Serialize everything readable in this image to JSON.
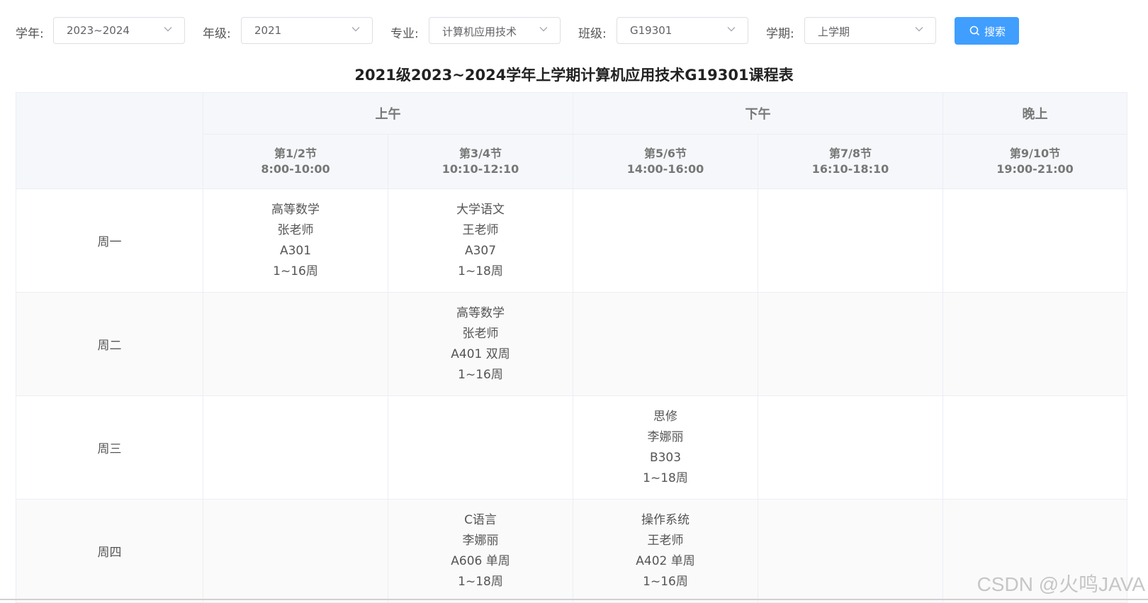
{
  "filters": [
    {
      "label": "学年:",
      "value": "2023~2024"
    },
    {
      "label": "年级:",
      "value": "2021"
    },
    {
      "label": "专业:",
      "value": "计算机应用技术"
    },
    {
      "label": "班级:",
      "value": "G19301"
    },
    {
      "label": "学期:",
      "value": "上学期"
    }
  ],
  "search_button": {
    "label": "搜索",
    "icon": "search-icon",
    "color": "#409eff"
  },
  "title": "2021级2023~2024学年上学期计算机应用技术G19301课程表",
  "table": {
    "groups": [
      "上午",
      "下午",
      "晚上"
    ],
    "periods": [
      {
        "name": "第1/2节",
        "time": "8:00-10:00"
      },
      {
        "name": "第3/4节",
        "time": "10:10-12:10"
      },
      {
        "name": "第5/6节",
        "time": "14:00-16:00"
      },
      {
        "name": "第7/8节",
        "time": "16:10-18:10"
      },
      {
        "name": "第9/10节",
        "time": "19:00-21:00"
      }
    ],
    "days": [
      {
        "day": "周一",
        "cells": [
          {
            "course": "高等数学",
            "teacher": "张老师",
            "room": "A301",
            "weeks": "1~16周"
          },
          {
            "course": "大学语文",
            "teacher": "王老师",
            "room": "A307",
            "weeks": "1~18周"
          },
          null,
          null,
          null
        ]
      },
      {
        "day": "周二",
        "cells": [
          null,
          {
            "course": "高等数学",
            "teacher": "张老师",
            "room": "A401 双周",
            "weeks": "1~16周"
          },
          null,
          null,
          null
        ]
      },
      {
        "day": "周三",
        "cells": [
          null,
          null,
          {
            "course": "思修",
            "teacher": "李娜丽",
            "room": "B303",
            "weeks": "1~18周"
          },
          null,
          null
        ]
      },
      {
        "day": "周四",
        "cells": [
          null,
          {
            "course": "C语言",
            "teacher": "李娜丽",
            "room": "A606 单周",
            "weeks": "1~18周"
          },
          {
            "course": "操作系统",
            "teacher": "王老师",
            "room": "A402 单周",
            "weeks": "1~16周"
          },
          null,
          null
        ]
      }
    ]
  },
  "watermark": "CSDN @火鸣JAVA"
}
